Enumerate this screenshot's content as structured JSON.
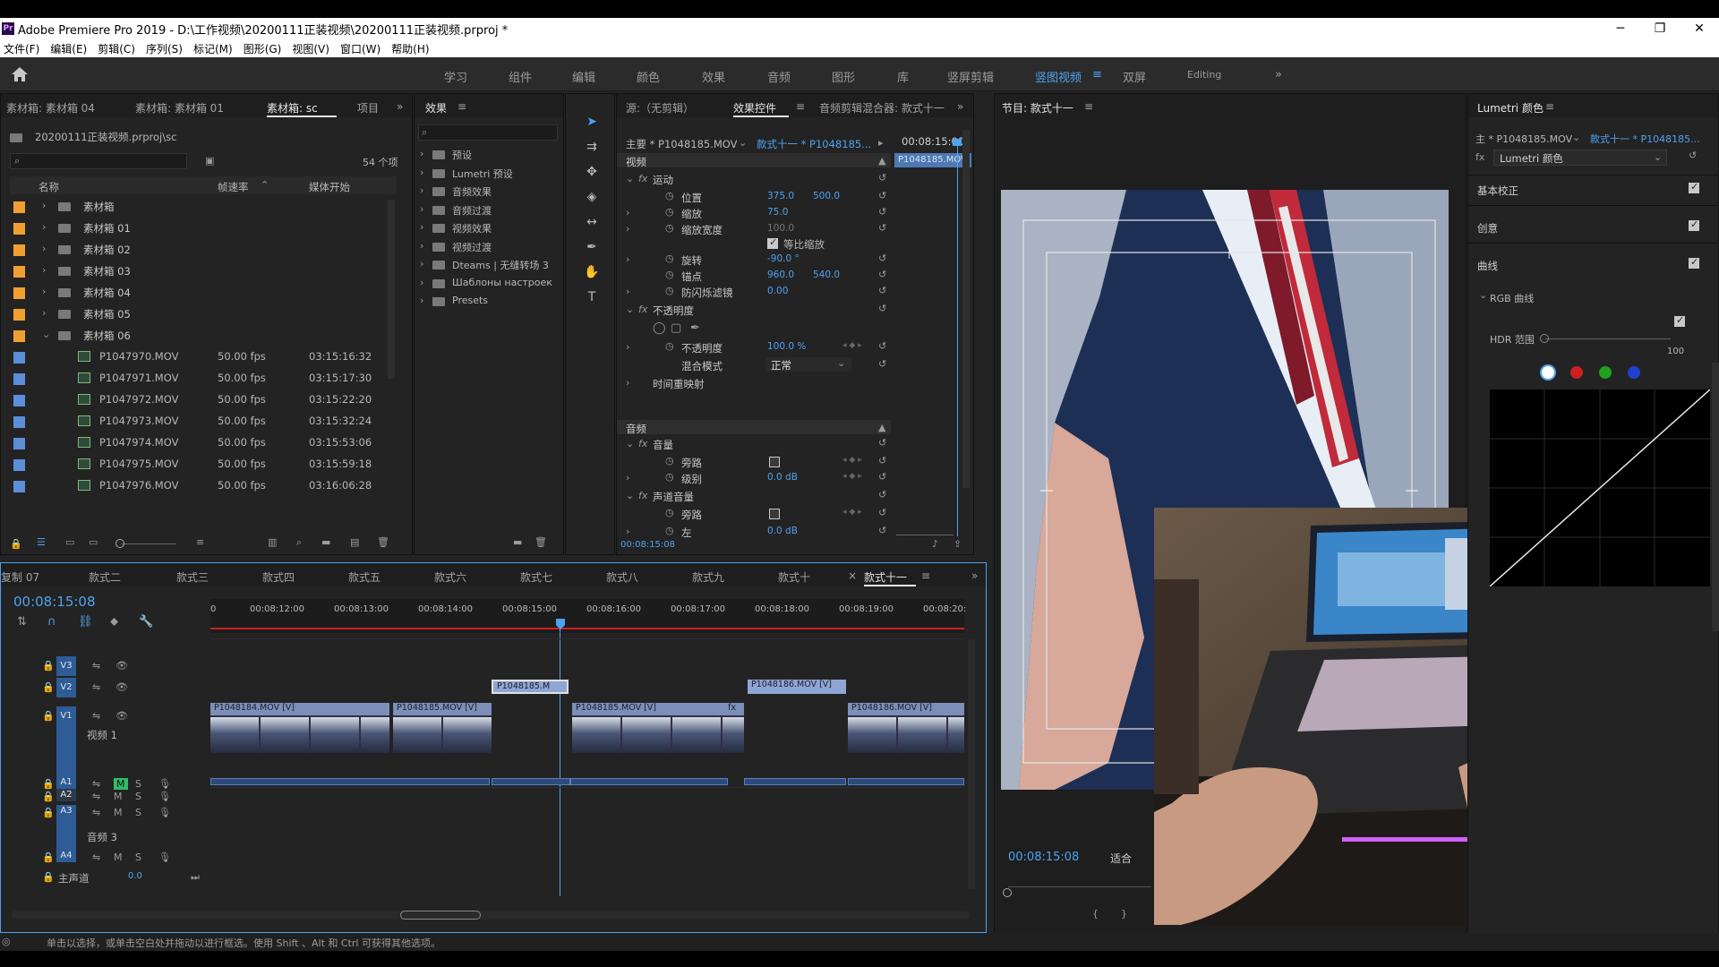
{
  "title_bar": {
    "app_abbr": "Pr",
    "title": "Adobe Premiere Pro 2019 - D:\\工作视频\\20200111正装视频\\20200111正装视频.prproj *"
  },
  "menu": [
    "文件(F)",
    "编辑(E)",
    "剪辑(C)",
    "序列(S)",
    "标记(M)",
    "图形(G)",
    "视图(V)",
    "窗口(W)",
    "帮助(H)"
  ],
  "workspaces": [
    "学习",
    "组件",
    "编辑",
    "颜色",
    "效果",
    "音频",
    "图形",
    "库",
    "竖屏剪辑",
    "竖图视频",
    "双屏",
    "Editing"
  ],
  "active_workspace_index": 9,
  "project": {
    "tabs": [
      "素材箱: 素材箱 04",
      "素材箱: 素材箱 01",
      "素材箱: sc",
      "项目"
    ],
    "path": "20200111正装视频.prproj\\sc",
    "item_count": "54 个项",
    "columns": [
      "名称",
      "帧速率",
      "媒体开始"
    ],
    "bins": [
      "素材箱",
      "素材箱 01",
      "素材箱 02",
      "素材箱 03",
      "素材箱 04",
      "素材箱 05",
      "素材箱 06"
    ],
    "clips": [
      {
        "name": "P1047970.MOV",
        "fps": "50.00 fps",
        "start": "03:15:16:32"
      },
      {
        "name": "P1047971.MOV",
        "fps": "50.00 fps",
        "start": "03:15:17:30"
      },
      {
        "name": "P1047972.MOV",
        "fps": "50.00 fps",
        "start": "03:15:22:20"
      },
      {
        "name": "P1047973.MOV",
        "fps": "50.00 fps",
        "start": "03:15:32:24"
      },
      {
        "name": "P1047974.MOV",
        "fps": "50.00 fps",
        "start": "03:15:53:06"
      },
      {
        "name": "P1047975.MOV",
        "fps": "50.00 fps",
        "start": "03:15:59:18"
      },
      {
        "name": "P1047976.MOV",
        "fps": "50.00 fps",
        "start": "03:16:06:28"
      }
    ],
    "bin_color": "#f0a030",
    "clip_color": "#5b8fd8"
  },
  "effects": {
    "tab": "效果",
    "items": [
      "预设",
      "Lumetri 预设",
      "音频效果",
      "音频过渡",
      "视频效果",
      "视频过渡",
      "Dteams | 无缝转场 3",
      "Шаблоны настроек",
      "Presets"
    ]
  },
  "effect_controls": {
    "tabs": [
      "源:（无剪辑）",
      "效果控件",
      "音频剪辑混合器: 款式十一"
    ],
    "master": "主要 * P1048185.MOV",
    "sequence_clip": "款式十一 * P1048185...",
    "timecode": "00:08:15:00",
    "clip_label": "P1048185.MOV",
    "section_video": "视频",
    "motion": "运动",
    "position_label": "位置",
    "position_x": "375.0",
    "position_y": "500.0",
    "scale_label": "缩放",
    "scale": "75.0",
    "scale_width_label": "缩放宽度",
    "scale_width": "100.0",
    "uniform_scale": "等比缩放",
    "rotation_label": "旋转",
    "rotation": "-90.0 °",
    "anchor_label": "锚点",
    "anchor_x": "960.0",
    "anchor_y": "540.0",
    "flicker_label": "防闪烁滤镜",
    "flicker": "0.00",
    "opacity_section": "不透明度",
    "opacity_label": "不透明度",
    "opacity": "100.0 %",
    "blend_label": "混合模式",
    "blend": "正常",
    "time_remap": "时间重映射",
    "section_audio": "音频",
    "volume": "音量",
    "bypass_label": "旁路",
    "level_label": "级别",
    "level": "0.0 dB",
    "channel_volume": "声道音量",
    "bypass2_label": "旁路",
    "left_label": "左",
    "left": "0.0 dB",
    "bottom_timecode": "00:08:15:08"
  },
  "program": {
    "tab": "节目: 款式十一",
    "timecode": "00:08:15:08",
    "fit": "适合"
  },
  "lumetri": {
    "tab": "Lumetri 颜色",
    "master": "主 * P1048185.MOV",
    "seq": "款式十一 * P1048185...",
    "fx": "Lumetri 颜色",
    "sections": [
      "基本校正",
      "创意",
      "曲线"
    ],
    "rgb_curves": "RGB 曲线",
    "hdr_label": "HDR 范围",
    "hdr_value": "100",
    "channel_colors": [
      "#ffffff",
      "#cc2020",
      "#20a020",
      "#2040d0"
    ]
  },
  "timeline": {
    "tabs": [
      "复制 07",
      "款式二",
      "款式三",
      "款式四",
      "款式五",
      "款式六",
      "款式七",
      "款式八",
      "款式九",
      "款式十",
      "款式十一"
    ],
    "timecode": "00:08:15:08",
    "ruler": [
      "00:08:12:00",
      "00:08:13:00",
      "00:08:14:00",
      "00:08:15:00",
      "00:08:16:00",
      "00:08:17:00",
      "00:08:18:00",
      "00:08:19:00",
      "00:08:20:"
    ],
    "tracks_video": [
      "V3",
      "V2",
      "V1"
    ],
    "v1_name": "视频 1",
    "tracks_audio": [
      "A1",
      "A2",
      "A3",
      "A4"
    ],
    "a3_name": "音频 3",
    "master_label": "主声道",
    "master_value": "0.0",
    "clips_v1": [
      "P1048184.MOV [V]",
      "P1048185.MOV [V]",
      "P1048185.MOV [V]",
      "fx",
      "P1048186.MOV [V]"
    ],
    "clips_v2": [
      "P1048185.M",
      "P1048186.MOV [V]"
    ]
  },
  "status": "单击以选择，或单击空白处并拖动以进行框选。使用 Shift 、Alt 和 Ctrl 可获得其他选项。"
}
